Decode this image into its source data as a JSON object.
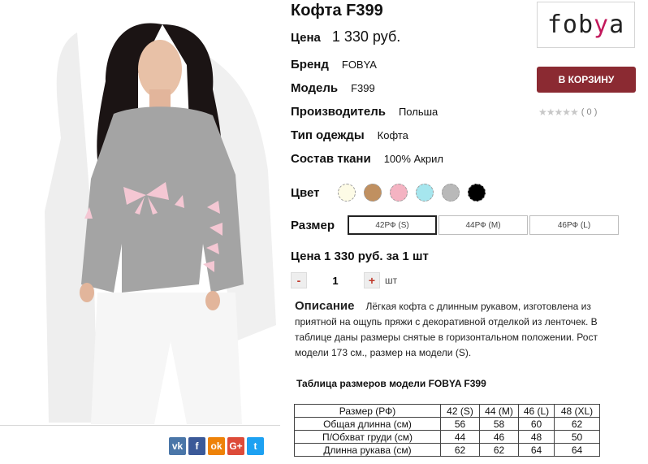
{
  "product": {
    "title": "Кофта F399",
    "price_label": "Цена",
    "price_value": "1 330 руб."
  },
  "specs": [
    {
      "label": "Бренд",
      "value": "FOBYA"
    },
    {
      "label": "Модель",
      "value": "F399"
    },
    {
      "label": "Производитель",
      "value": "Польша"
    },
    {
      "label": "Тип одежды",
      "value": "Кофта"
    },
    {
      "label": "Состав ткани",
      "value": "100% Акрил"
    }
  ],
  "colors": {
    "label": "Цвет",
    "swatches": [
      {
        "name": "cream",
        "hex": "#fdfbe6"
      },
      {
        "name": "camel",
        "hex": "#c09060"
      },
      {
        "name": "pink",
        "hex": "#f4b3c2"
      },
      {
        "name": "light-blue",
        "hex": "#a6e6ee"
      },
      {
        "name": "grey",
        "hex": "#b9b9b9"
      },
      {
        "name": "black",
        "hex": "#000000"
      }
    ]
  },
  "sizes": {
    "label": "Размер",
    "options": [
      "42РФ (S)",
      "44РФ (M)",
      "46РФ (L)"
    ],
    "selected_index": 0
  },
  "quantity": {
    "summary": "Цена 1 330 руб. за 1 шт",
    "minus": "-",
    "plus": "+",
    "value": "1",
    "unit": "шт"
  },
  "description": {
    "heading": "Описание",
    "text": "Лёгкая кофта с длинным рукавом, изготовлена из приятной на ощупь пряжи с декоративной отделкой из ленточек. В таблице даны размеры снятые в горизонтальном положении. Рост модели 173 см., размер на модели (S)."
  },
  "size_table": {
    "title": "Таблица размеров модели FOBYA F399",
    "header": [
      "Размер (РФ)",
      "42 (S)",
      "44 (M)",
      "46 (L)",
      "48 (XL)"
    ],
    "rows": [
      [
        "Общая длинна (см)",
        "56",
        "58",
        "60",
        "62"
      ],
      [
        "П/Обхват груди (см)",
        "44",
        "46",
        "48",
        "50"
      ],
      [
        "Длинна рукава (см)",
        "62",
        "62",
        "64",
        "64"
      ]
    ]
  },
  "brand_logo": {
    "part1": "fob",
    "part2": "y",
    "part3": "a"
  },
  "cart_button": "В КОРЗИНУ",
  "rating": {
    "stars": "★★★★★",
    "count": "( 0 )",
    "value": 0
  },
  "share": [
    {
      "icon": "vk-icon",
      "glyph": "vk",
      "color": "#4a76a8"
    },
    {
      "icon": "facebook-icon",
      "glyph": "f",
      "color": "#3b5998"
    },
    {
      "icon": "odnoklassniki-icon",
      "glyph": "ok",
      "color": "#ee8208"
    },
    {
      "icon": "google-plus-icon",
      "glyph": "G+",
      "color": "#dd4b39"
    },
    {
      "icon": "twitter-icon",
      "glyph": "t",
      "color": "#1da1f2"
    }
  ]
}
